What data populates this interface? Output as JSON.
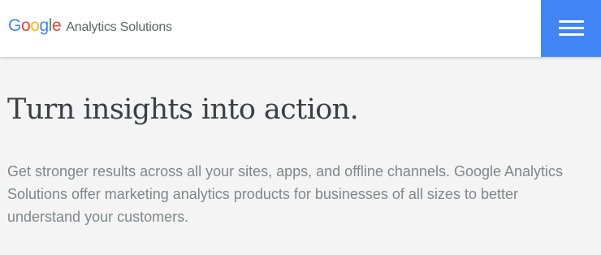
{
  "header": {
    "logo": {
      "letters": [
        {
          "char": "G",
          "color": "#4285f4"
        },
        {
          "char": "o",
          "color": "#ea4335"
        },
        {
          "char": "o",
          "color": "#fbbc05"
        },
        {
          "char": "g",
          "color": "#4285f4"
        },
        {
          "char": "l",
          "color": "#34a853"
        },
        {
          "char": "e",
          "color": "#ea4335"
        }
      ],
      "product_name": "Analytics Solutions"
    },
    "menu_button": {
      "icon": "hamburger-menu-icon",
      "color": "#4285f4"
    }
  },
  "hero": {
    "headline": "Turn insights into action.",
    "description": "Get stronger results across all your sites, apps, and offline channels. Google Analytics Solutions offer marketing analytics products for businesses of all sizes to better understand your customers."
  },
  "colors": {
    "page_background": "#f4f4f4",
    "header_background": "#ffffff",
    "accent": "#4285f4",
    "headline_text": "#3c4043",
    "body_text": "#80868b"
  }
}
